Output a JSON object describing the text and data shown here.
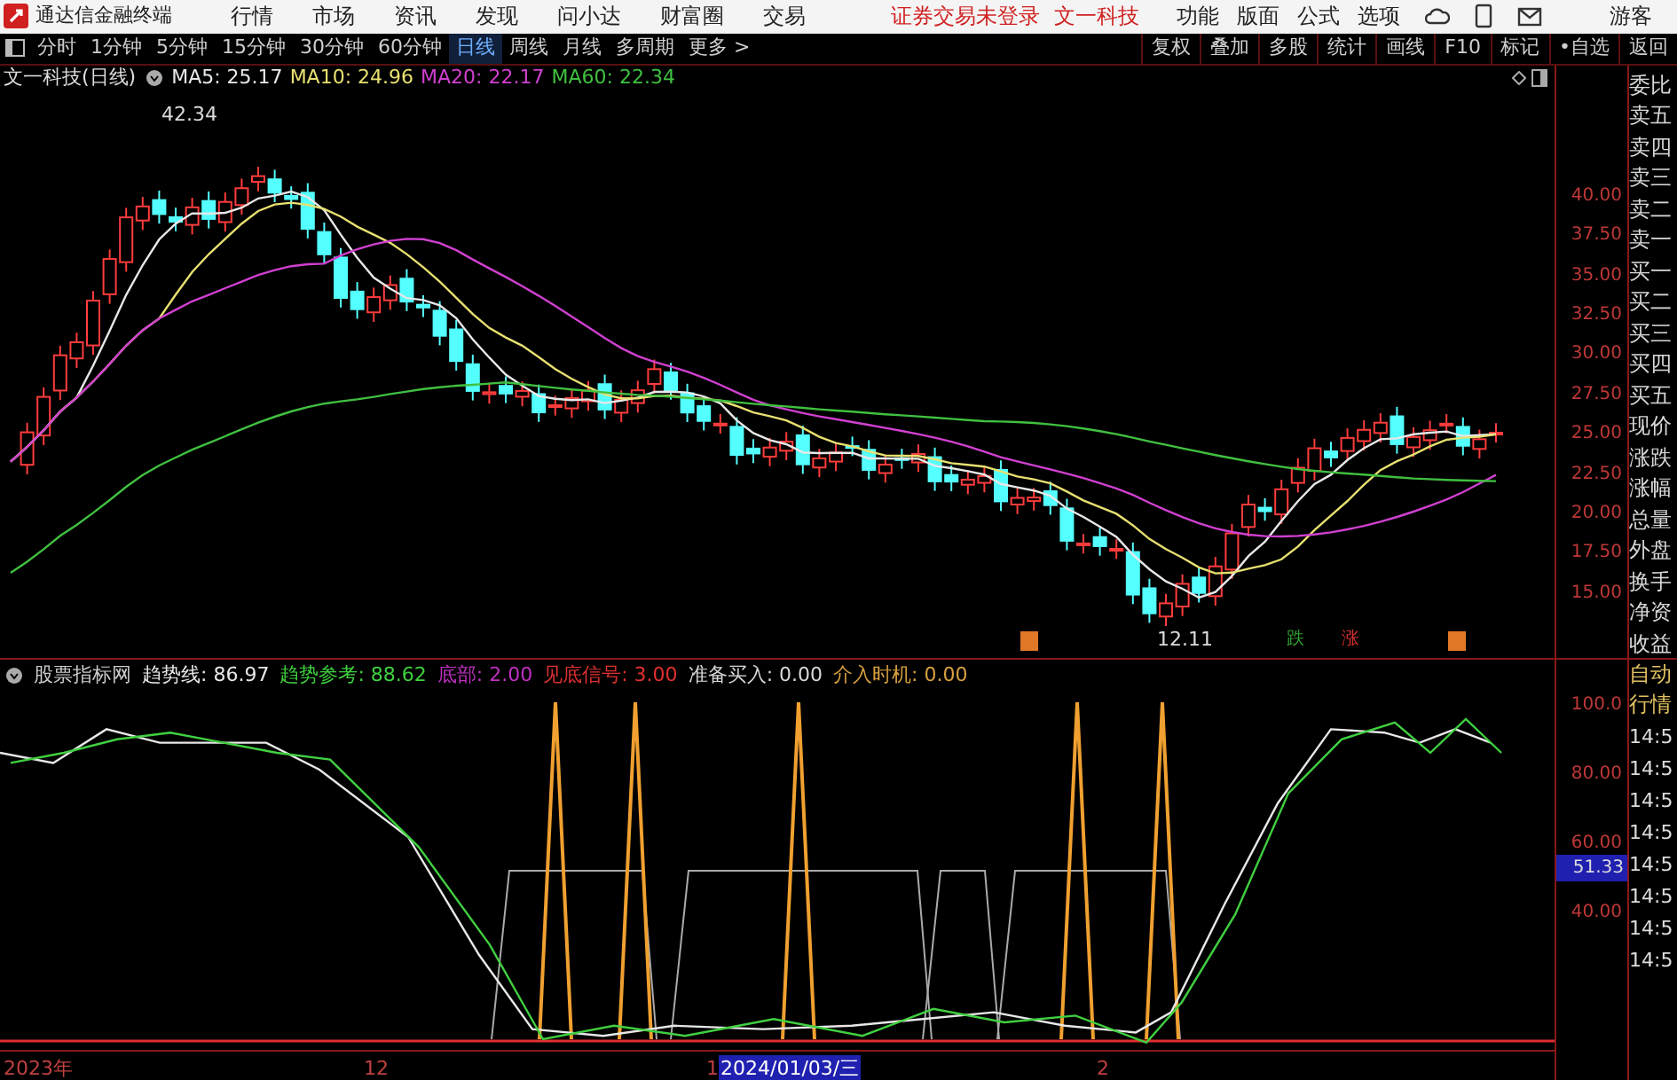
{
  "top_bar": {
    "app_name": "通达信金融终端",
    "menu": [
      "行情",
      "市场",
      "资讯",
      "发现",
      "问小达",
      "财富圈",
      "交易"
    ],
    "login_status": "证券交易未登录",
    "stock_name": "文一科技",
    "right_menu": [
      "功能",
      "版面",
      "公式",
      "选项"
    ],
    "user": "游客"
  },
  "toolbar": {
    "periods": [
      {
        "label": "分时",
        "selected": false
      },
      {
        "label": "1分钟",
        "selected": false
      },
      {
        "label": "5分钟",
        "selected": false
      },
      {
        "label": "15分钟",
        "selected": false
      },
      {
        "label": "30分钟",
        "selected": false
      },
      {
        "label": "60分钟",
        "selected": false
      },
      {
        "label": "日线",
        "selected": true
      },
      {
        "label": "周线",
        "selected": false
      },
      {
        "label": "月线",
        "selected": false
      },
      {
        "label": "多周期",
        "selected": false
      }
    ],
    "more": "更多 >",
    "actions": [
      "复权",
      "叠加",
      "多股",
      "统计",
      "画线",
      "F10",
      "标记",
      "•自选",
      "返回"
    ]
  },
  "main_chart": {
    "title": "文一科技(日线)",
    "legend": [
      {
        "label": "MA5: 25.17",
        "color": "#e8e8e8"
      },
      {
        "label": "MA10: 24.96",
        "color": "#e8e070"
      },
      {
        "label": "MA20: 22.17",
        "color": "#d040d0"
      },
      {
        "label": "MA60: 22.34",
        "color": "#40c040"
      }
    ],
    "high_label": "42.34",
    "low_label": "12.11",
    "signals": [
      {
        "kind": "mark",
        "color": "#e07828"
      },
      {
        "kind": "text",
        "label": "跌",
        "color": "#30a030"
      },
      {
        "kind": "text",
        "label": "涨",
        "color": "#d03030"
      },
      {
        "kind": "mark",
        "color": "#e07828"
      }
    ],
    "price_axis": [
      "40.00",
      "37.50",
      "35.00",
      "32.50",
      "30.00",
      "27.50",
      "25.00",
      "22.50",
      "20.00",
      "17.50",
      "15.00"
    ]
  },
  "indicator": {
    "title": "股票指标网",
    "legend": [
      {
        "label": "趋势线: 86.97",
        "color": "#e8e8e8"
      },
      {
        "label": "趋势参考: 88.62",
        "color": "#40d040"
      },
      {
        "label": "底部: 2.00",
        "color": "#c030c0"
      },
      {
        "label": "见底信号: 3.00",
        "color": "#e03030"
      },
      {
        "label": "准备买入: 0.00",
        "color": "#d8d8d8"
      },
      {
        "label": "介入时机: 0.00",
        "color": "#d8a040"
      }
    ],
    "axis": [
      "100.0",
      "80.00",
      "60.00",
      "40.00"
    ],
    "current_value": "51.33"
  },
  "quote_panel": {
    "labels": [
      "委比",
      "卖五",
      "卖四",
      "卖三",
      "卖二",
      "卖一",
      "买一",
      "买二",
      "买三",
      "买四",
      "买五",
      "现价",
      "涨跌",
      "涨幅",
      "总量",
      "外盘",
      "换手",
      "净资",
      "收益"
    ],
    "tabs": [
      "自动",
      "行情"
    ],
    "times": [
      "14:5",
      "14:5",
      "14:5",
      "14:5",
      "14:5",
      "14:5",
      "14:5",
      "14:5"
    ]
  },
  "date_axis": [
    {
      "label": "2023年",
      "selected": false
    },
    {
      "label": "12",
      "selected": false
    },
    {
      "label": "1",
      "selected": false
    },
    {
      "label": "2024/01/03/三",
      "selected": true
    },
    {
      "label": "2",
      "selected": false
    }
  ]
}
